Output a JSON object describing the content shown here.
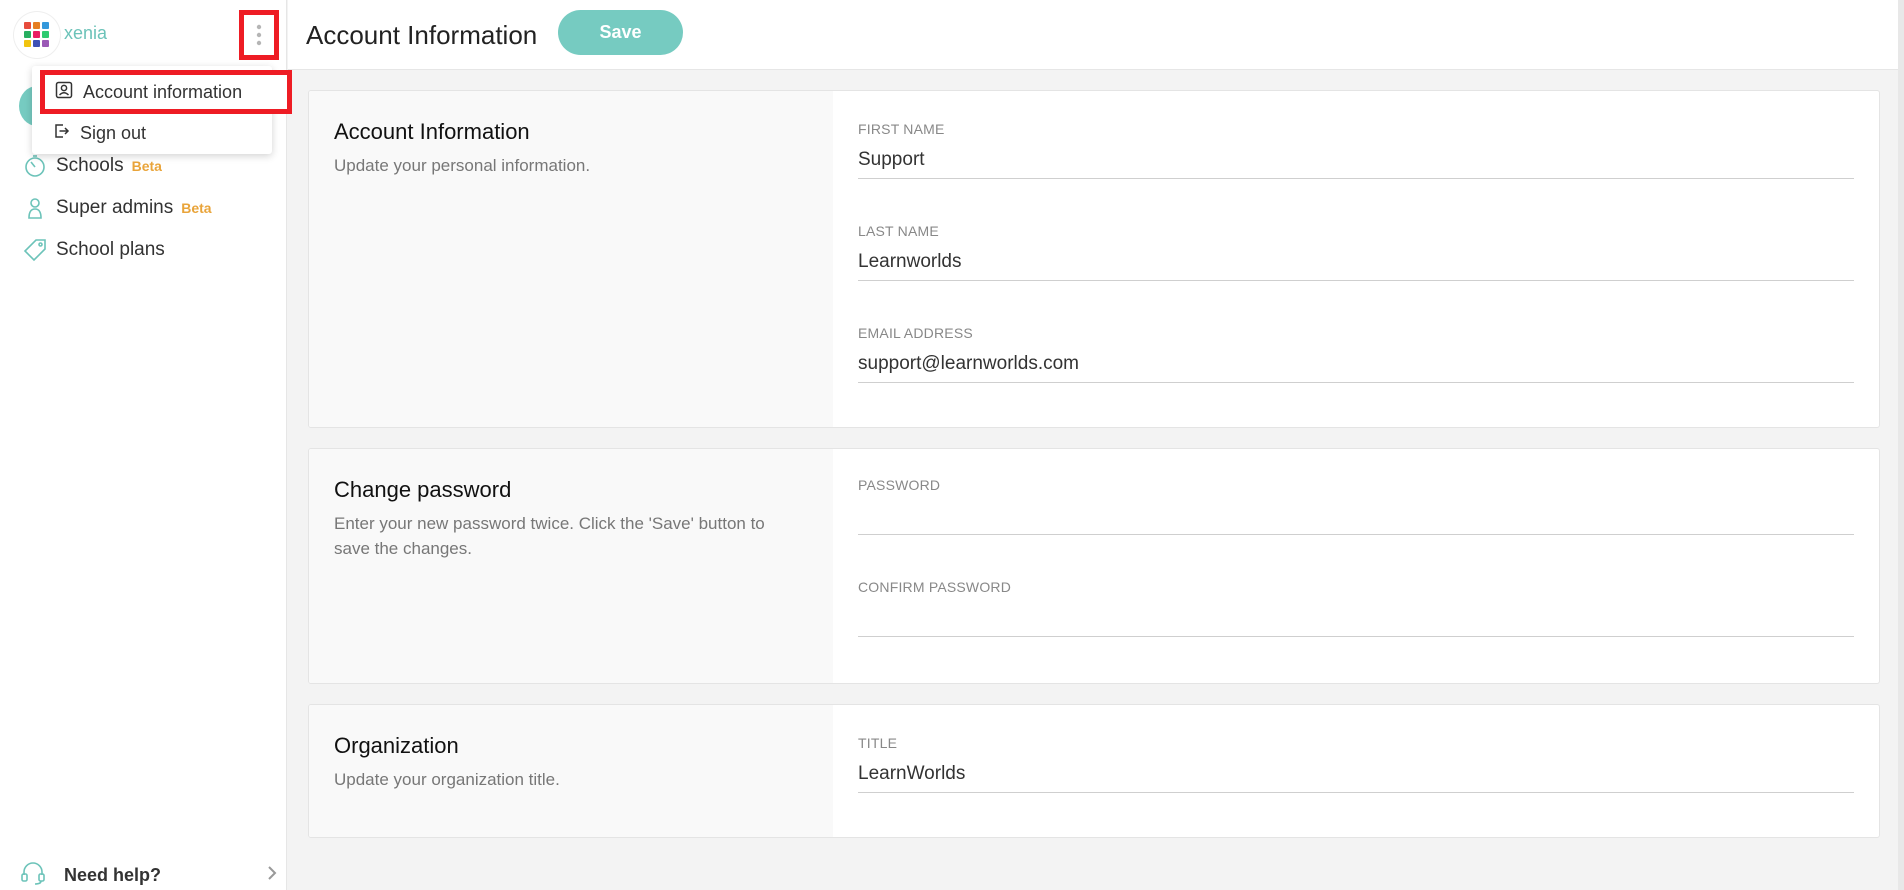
{
  "sidebar": {
    "username": "xenia",
    "brand_colors": [
      "#e74c3c",
      "#e67e22",
      "#3498db",
      "#27ae60",
      "#e91e63",
      "#2ecc71",
      "#f1c40f",
      "#3f51b5",
      "#9b59b6"
    ],
    "nav": [
      {
        "label": "Schools",
        "badge": "Beta",
        "icon": "stopwatch-icon"
      },
      {
        "label": "Super admins",
        "badge": "Beta",
        "icon": "user-icon"
      },
      {
        "label": "School plans",
        "badge": "",
        "icon": "tag-icon"
      }
    ],
    "help_label": "Need help?"
  },
  "menu": {
    "items": [
      {
        "label": "Account information",
        "icon": "account-box-icon"
      },
      {
        "label": "Sign out",
        "icon": "sign-out-icon"
      }
    ]
  },
  "header": {
    "title": "Account Information",
    "save_label": "Save"
  },
  "sections": {
    "account": {
      "title": "Account Information",
      "description": "Update your personal information.",
      "fields": [
        {
          "label": "FIRST NAME",
          "value": "Support"
        },
        {
          "label": "LAST NAME",
          "value": "Learnworlds"
        },
        {
          "label": "EMAIL ADDRESS",
          "value": "support@learnworlds.com"
        }
      ]
    },
    "password": {
      "title": "Change password",
      "description": "Enter your new password twice. Click the 'Save' button to save the changes.",
      "fields": [
        {
          "label": "PASSWORD",
          "value": ""
        },
        {
          "label": "CONFIRM PASSWORD",
          "value": ""
        }
      ]
    },
    "organization": {
      "title": "Organization",
      "description": "Update your organization title.",
      "fields": [
        {
          "label": "TITLE",
          "value": "LearnWorlds"
        }
      ]
    }
  },
  "colors": {
    "accent": "#76cbc1",
    "beta": "#e9a43a",
    "highlight": "#ee1c24"
  }
}
